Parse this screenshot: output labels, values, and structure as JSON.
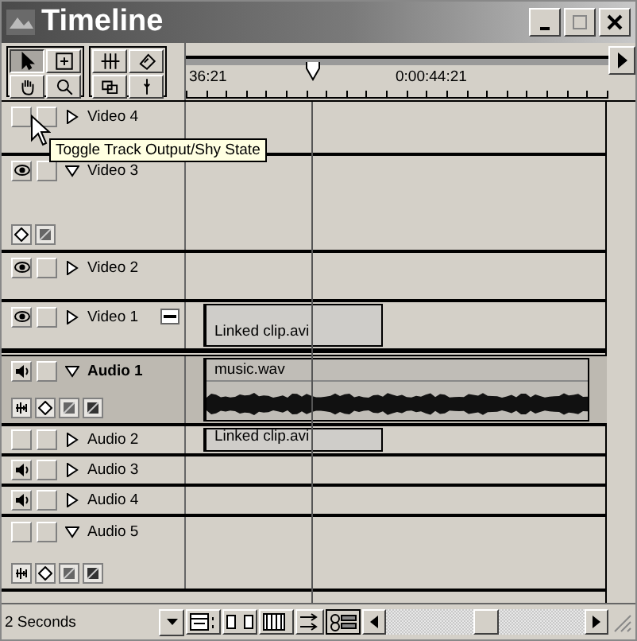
{
  "window": {
    "title": "Timeline"
  },
  "tools": [
    {
      "kind": "arrow",
      "selected": true
    },
    {
      "kind": "marquee",
      "selected": false
    },
    {
      "kind": "track",
      "selected": false
    },
    {
      "kind": "edit",
      "selected": false
    },
    {
      "kind": "hand",
      "selected": false
    },
    {
      "kind": "zoom",
      "selected": false
    },
    {
      "kind": "link",
      "selected": false
    },
    {
      "kind": "razor",
      "selected": false
    }
  ],
  "ruler": {
    "labels": [
      "36:21",
      "0:00:44:21"
    ]
  },
  "tracks": [
    {
      "name": "Video 4",
      "kind": "video",
      "output": false,
      "expanded": false,
      "selected": false
    },
    {
      "name": "Video 3",
      "kind": "video",
      "output": true,
      "expanded": true,
      "selected": false
    },
    {
      "name": "Video 2",
      "kind": "video",
      "output": true,
      "expanded": false,
      "selected": false
    },
    {
      "name": "Video 1",
      "kind": "video",
      "output": true,
      "expanded": false,
      "selected": false,
      "clips": [
        {
          "kind": "linked",
          "label": "Linked clip.avi"
        }
      ]
    },
    {
      "name": "Audio 1",
      "kind": "audio",
      "output": true,
      "expanded": true,
      "selected": true,
      "clips": [
        {
          "kind": "wave",
          "label": "music.wav"
        }
      ]
    },
    {
      "name": "Audio 2",
      "kind": "audio",
      "output": false,
      "expanded": false,
      "selected": false,
      "clips": [
        {
          "kind": "linked",
          "label": "Linked clip.avi"
        }
      ]
    },
    {
      "name": "Audio 3",
      "kind": "audio",
      "output": true,
      "expanded": false,
      "selected": false
    },
    {
      "name": "Audio 4",
      "kind": "audio",
      "output": true,
      "expanded": false,
      "selected": false
    },
    {
      "name": "Audio 5",
      "kind": "audio",
      "output": false,
      "expanded": true,
      "selected": false
    }
  ],
  "tooltip": "Toggle Track Output/Shy State",
  "status_bar": {
    "time_unit": "2 Seconds"
  }
}
